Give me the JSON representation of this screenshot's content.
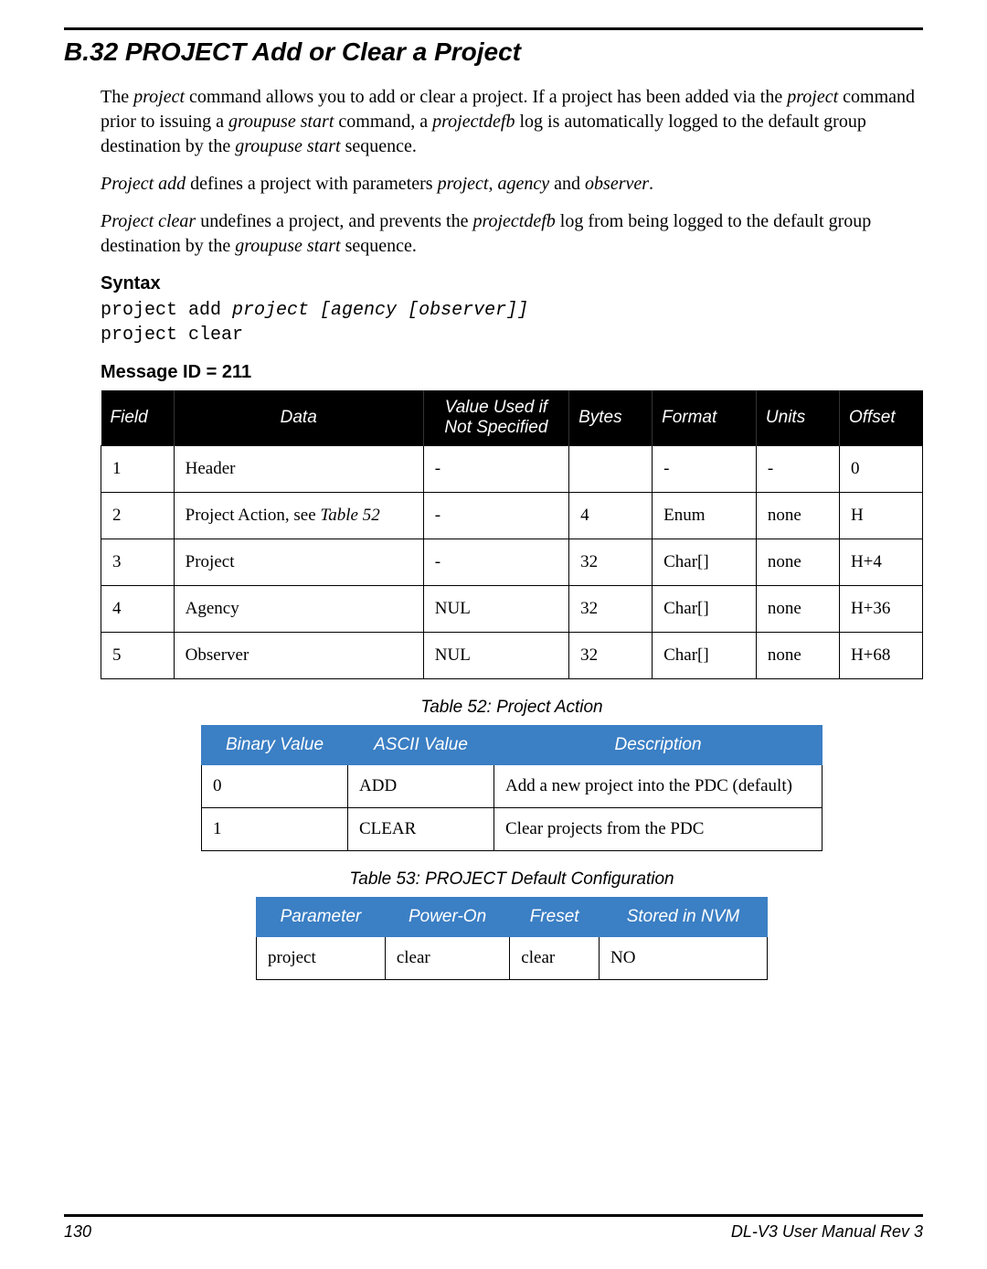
{
  "section_title": "B.32  PROJECT   Add or Clear a Project",
  "paragraphs": {
    "p1_a": "The ",
    "p1_b": "project",
    "p1_c": " command allows you to add or clear a project. If a project has been added via the ",
    "p1_d": "project",
    "p1_e": " command prior to issuing a ",
    "p1_f": "groupuse start",
    "p1_g": " command, a ",
    "p1_h": "projectdefb",
    "p1_i": " log is automatically logged to the default group destination by the ",
    "p1_j": "groupuse start",
    "p1_k": " sequence.",
    "p2_a": "Project add",
    "p2_b": " defines a project with parameters ",
    "p2_c": "project",
    "p2_d": ", ",
    "p2_e": "agency",
    "p2_f": " and ",
    "p2_g": "observer",
    "p2_h": ".",
    "p3_a": "Project clear",
    "p3_b": " undefines a project, and prevents the ",
    "p3_c": "projectdefb",
    "p3_d": " log from being logged to the default group destination by the ",
    "p3_e": "groupuse start",
    "p3_f": " sequence."
  },
  "syntax": {
    "heading": "Syntax",
    "line1_a": "project add ",
    "line1_b": "project [agency [observer]]",
    "line2": "project clear"
  },
  "message_id_heading": "Message ID = 211",
  "table1": {
    "headers": {
      "field": "Field",
      "data": "Data",
      "value": "Value Used if Not Specified",
      "bytes": "Bytes",
      "format": "Format",
      "units": "Units",
      "offset": "Offset"
    },
    "rows": [
      {
        "field": "1",
        "data": "Header",
        "data_ital": "",
        "value": "-",
        "bytes": "",
        "format": "-",
        "units": "-",
        "offset": "0"
      },
      {
        "field": "2",
        "data": "Project Action, see ",
        "data_ital": "Table 52",
        "value": "-",
        "bytes": "4",
        "format": "Enum",
        "units": "none",
        "offset": "H"
      },
      {
        "field": "3",
        "data": "Project",
        "data_ital": "",
        "value": "-",
        "bytes": "32",
        "format": "Char[]",
        "units": "none",
        "offset": "H+4"
      },
      {
        "field": "4",
        "data": "Agency",
        "data_ital": "",
        "value": "NUL",
        "bytes": "32",
        "format": "Char[]",
        "units": "none",
        "offset": "H+36"
      },
      {
        "field": "5",
        "data": "Observer",
        "data_ital": "",
        "value": "NUL",
        "bytes": "32",
        "format": "Char[]",
        "units": "none",
        "offset": "H+68"
      }
    ]
  },
  "table2": {
    "caption": "Table 52: Project Action",
    "headers": {
      "bv": "Binary Value",
      "av": "ASCII Value",
      "desc": "Description"
    },
    "rows": [
      {
        "bv": "0",
        "av": "ADD",
        "desc": "Add a new project into the PDC (default)"
      },
      {
        "bv": "1",
        "av": "CLEAR",
        "desc": "Clear projects from the PDC"
      }
    ]
  },
  "table3": {
    "caption": "Table 53: PROJECT Default Configuration",
    "headers": {
      "param": "Parameter",
      "poweron": "Power-On",
      "freset": "Freset",
      "nvm": "Stored in NVM"
    },
    "row": {
      "param": "project",
      "poweron": "clear",
      "freset": "clear",
      "nvm": "NO"
    }
  },
  "footer": {
    "page": "130",
    "docrev": "DL-V3 User Manual Rev 3"
  }
}
